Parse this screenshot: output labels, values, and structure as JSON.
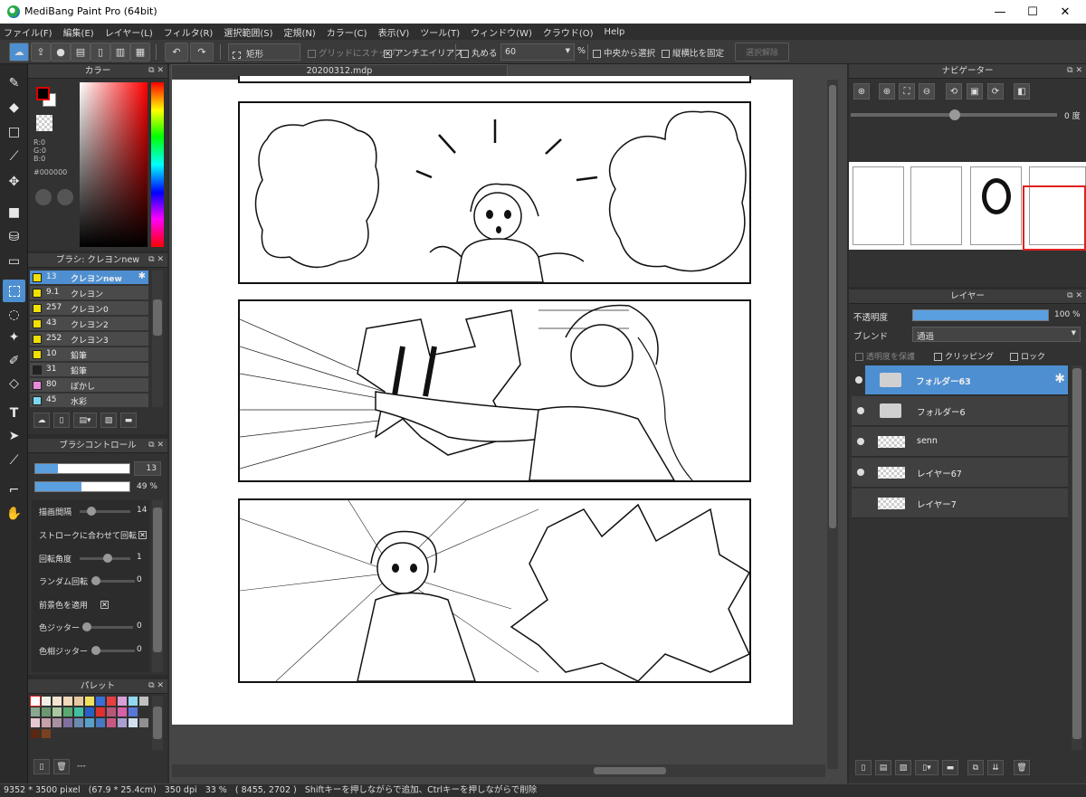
{
  "window": {
    "title": "MediBang Paint Pro (64bit)",
    "controls": [
      "—",
      "☐",
      "✕"
    ]
  },
  "menu": [
    "ファイル(F)",
    "編集(E)",
    "レイヤー(L)",
    "フィルタ(R)",
    "選択範囲(S)",
    "定規(N)",
    "カラー(C)",
    "表示(V)",
    "ツール(T)",
    "ウィンドウ(W)",
    "クラウド(O)",
    "Help"
  ],
  "toolbar": {
    "shape_value": "矩形",
    "grid_snap": "グリッドにスナップ",
    "antialias": "アンチエイリアス",
    "round": "丸める",
    "round_value": "60",
    "percent": "%",
    "select_center": "中央から選択",
    "fix_ratio": "縦横比を固定",
    "deselect": "選択解除"
  },
  "color_panel": {
    "title": "カラー",
    "r": "R:0",
    "g": "G:0",
    "b": "B:0",
    "hex": "#000000"
  },
  "brush_panel": {
    "title": "ブラシ: クレヨンnew",
    "items": [
      {
        "size": "13",
        "name": "クレヨンnew",
        "color": "#f0e000",
        "selected": true
      },
      {
        "size": "9.1",
        "name": "クレヨン",
        "color": "#f0e000"
      },
      {
        "size": "257",
        "name": "クレヨン0",
        "color": "#f0e000"
      },
      {
        "size": "43",
        "name": "クレヨン2",
        "color": "#f0e000"
      },
      {
        "size": "252",
        "name": "クレヨン3",
        "color": "#f0e000"
      },
      {
        "size": "10",
        "name": "鉛筆",
        "color": "#f0e000"
      },
      {
        "size": "31",
        "name": "鉛筆",
        "color": "#222222"
      },
      {
        "size": "80",
        "name": "ぼかし",
        "color": "#e88ad8"
      },
      {
        "size": "45",
        "name": "水彩",
        "color": "#7ad8f0"
      }
    ]
  },
  "brush_control": {
    "title": "ブラシコントロール",
    "size_value": "13",
    "opacity_value": "49 %",
    "spacing_label": "描画間隔",
    "spacing_value": "14",
    "rotate_stroke_label": "ストロークに合わせて回転",
    "angle_label": "回転角度",
    "angle_value": "1",
    "random_label": "ランダム回転",
    "random_value": "0",
    "fg_label": "前景色を適用",
    "jitter_label": "色ジッター",
    "jitter_value": "0",
    "hue_jitter_label": "色相ジッター",
    "hue_jitter_value": "0"
  },
  "palette_panel": {
    "title": "パレット",
    "footer": "---"
  },
  "document": {
    "tab": "20200312.mdp"
  },
  "navigator": {
    "title": "ナビゲーター",
    "angle": "0 度"
  },
  "layer_panel": {
    "title": "レイヤー",
    "opacity_label": "不透明度",
    "opacity_value": "100 %",
    "opacity_fill": 1.0,
    "blend_label": "ブレンド",
    "blend_value": "通過",
    "protect": "透明度を保護",
    "clipping": "クリッピング",
    "lock": "ロック",
    "layers": [
      {
        "name": "フォルダー63",
        "type": "folder",
        "visible": true,
        "selected": true
      },
      {
        "name": "フォルダー6",
        "type": "folder",
        "visible": true
      },
      {
        "name": "senn",
        "type": "layer",
        "visible": true
      },
      {
        "name": "レイヤー67",
        "type": "layer",
        "visible": true
      },
      {
        "name": "レイヤー7",
        "type": "layer",
        "visible": false
      }
    ]
  },
  "status": {
    "size": "9352 * 3500 pixel",
    "cm": "(67.9 * 25.4cm)",
    "dpi": "350 dpi",
    "zoom": "33 %",
    "coords": "( 8455, 2702 )",
    "hint": "Shiftキーを押しながらで追加、Ctrlキーを押しながらで削除"
  }
}
